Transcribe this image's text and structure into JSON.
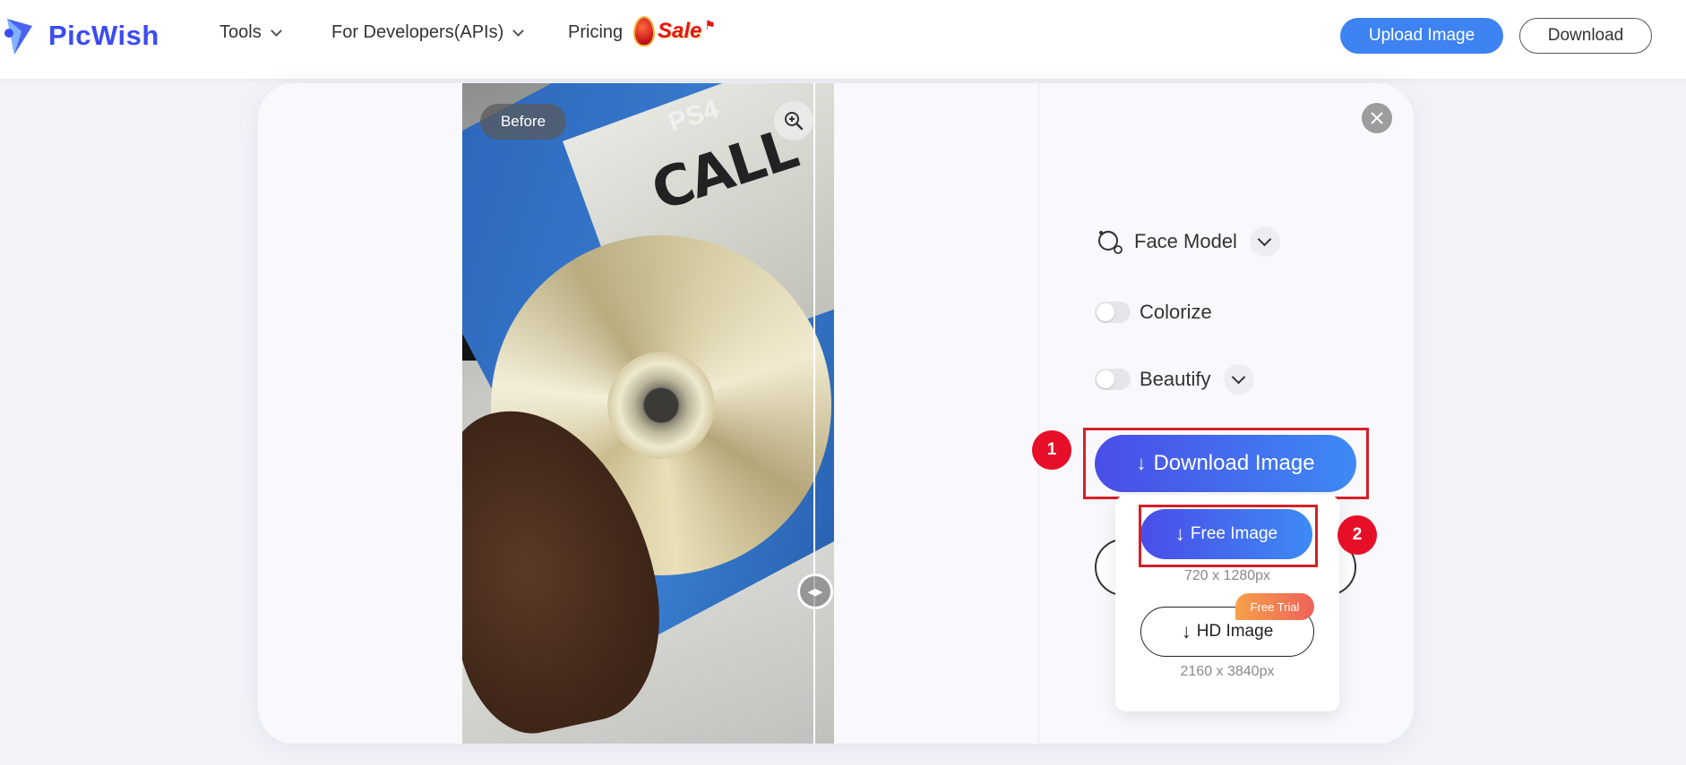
{
  "header": {
    "brand": "PicWish",
    "nav": [
      {
        "label": "Tools"
      },
      {
        "label": "For Developers(APIs)"
      },
      {
        "label": "Pricing"
      }
    ],
    "sale_label": "Sale",
    "upload_label": "Upload Image",
    "download_label": "Download"
  },
  "preview": {
    "before_label": "Before",
    "zoom_icon": "zoom-in-icon",
    "compare_handle_icon": "left-right-arrows-icon"
  },
  "options": {
    "face_model_label": "Face Model",
    "colorize_label": "Colorize",
    "colorize_on": false,
    "beautify_label": "Beautify",
    "beautify_on": false
  },
  "download": {
    "main_label": "Download Image",
    "free_label": "Free Image",
    "free_res": "720 x 1280px",
    "hd_label": "HD Image",
    "hd_res": "2160 x 3840px",
    "trial_badge": "Free Trial"
  },
  "annotations": {
    "step1": "1",
    "step2": "2"
  },
  "colors": {
    "brand": "#3b4cf0",
    "accent": "#3d83f2",
    "highlight": "#d32027",
    "step_badge": "#e60f27"
  }
}
